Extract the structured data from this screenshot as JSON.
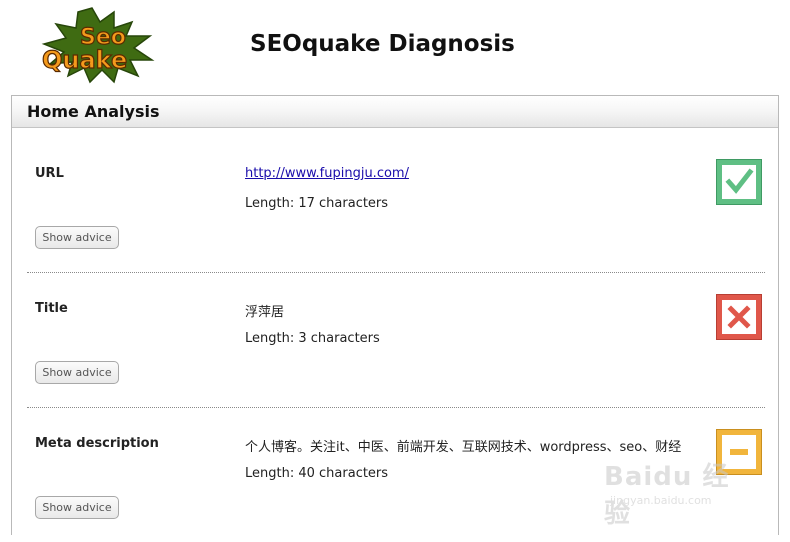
{
  "header": {
    "logo_alt": "SeoQuake",
    "title": "SEOquake Diagnosis"
  },
  "panel": {
    "title": "Home Analysis"
  },
  "sections": [
    {
      "label": "URL",
      "value": "http://www.fupingju.com/",
      "length": "Length: 17 characters",
      "advice_button": "Show advice",
      "status": "pass"
    },
    {
      "label": "Title",
      "value": "浮萍居",
      "length": "Length: 3 characters",
      "advice_button": "Show advice",
      "status": "fail"
    },
    {
      "label": "Meta description",
      "value": "个人博客。关注it、中医、前端开发、互联网技术、wordpress、seo、财经",
      "length": "Length: 40 characters",
      "advice_button": "Show advice",
      "status": "warning"
    }
  ],
  "colors": {
    "pass": "#5fbf84",
    "fail": "#e0574a",
    "warning": "#f1b53c"
  },
  "watermark": {
    "text": "Baidu 经验",
    "url": "jingyan.baidu.com"
  }
}
